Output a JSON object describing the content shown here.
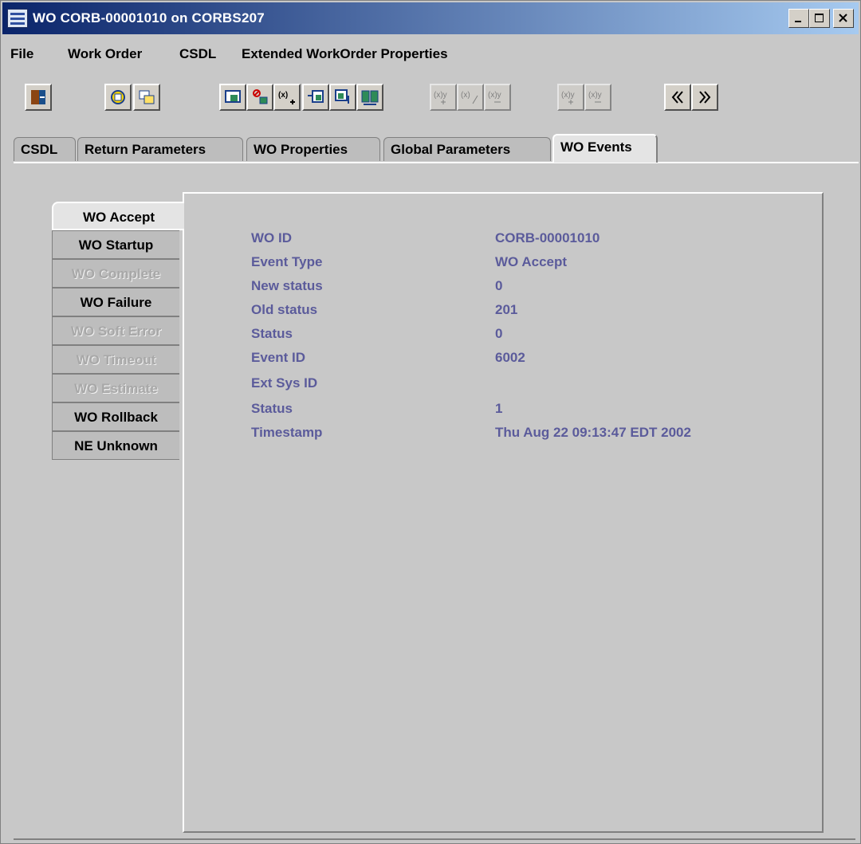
{
  "window": {
    "title": "WO CORB-00001010 on CORBS207",
    "controls": [
      "minimize-icon",
      "maximize-icon",
      "close-icon"
    ]
  },
  "menu": {
    "file": "File",
    "work_order": "Work Order",
    "csdl": "CSDL",
    "extended": "Extended WorkOrder Properties"
  },
  "toolbar": {
    "buttons": [
      {
        "icon": "exit-icon",
        "enabled": true
      },
      {
        "icon": "refresh-icon",
        "enabled": true
      },
      {
        "icon": "copy-window-icon",
        "enabled": true
      },
      {
        "icon": "window-in-icon",
        "enabled": true
      },
      {
        "icon": "cancel-window-icon",
        "enabled": true
      },
      {
        "icon": "add-variable-icon",
        "label": "(x)",
        "enabled": true
      },
      {
        "icon": "window-left-icon",
        "enabled": true
      },
      {
        "icon": "window-down-icon",
        "enabled": true
      },
      {
        "icon": "window-swap-icon",
        "enabled": true
      },
      {
        "icon": "add-var-icon",
        "label": "(x)y",
        "enabled": false
      },
      {
        "icon": "edit-var-icon",
        "label": "(x)",
        "enabled": false
      },
      {
        "icon": "remove-var-icon",
        "label": "(x)y",
        "enabled": false
      },
      {
        "icon": "add-var2-icon",
        "label": "(x)y",
        "enabled": false
      },
      {
        "icon": "remove-var2-icon",
        "label": "(x)y",
        "enabled": false
      },
      {
        "icon": "previous-icon",
        "enabled": true
      },
      {
        "icon": "next-icon",
        "enabled": true
      }
    ]
  },
  "tabs": [
    {
      "label": "CSDL"
    },
    {
      "label": "Return Parameters"
    },
    {
      "label": "WO Properties"
    },
    {
      "label": "Global Parameters"
    },
    {
      "label": "WO Events",
      "active": true
    }
  ],
  "event_tabs": [
    {
      "label": "WO Accept",
      "state": "active"
    },
    {
      "label": "WO Startup",
      "state": "enabled"
    },
    {
      "label": "WO Complete",
      "state": "disabled"
    },
    {
      "label": "WO Failure",
      "state": "enabled"
    },
    {
      "label": "WO Soft Error",
      "state": "disabled"
    },
    {
      "label": "WO Timeout",
      "state": "disabled"
    },
    {
      "label": "WO Estimate",
      "state": "disabled"
    },
    {
      "label": "WO Rollback",
      "state": "enabled"
    },
    {
      "label": "NE Unknown",
      "state": "enabled"
    }
  ],
  "event_details": [
    {
      "label": "WO ID",
      "value": "CORB-00001010"
    },
    {
      "label": "Event Type",
      "value": "WO Accept"
    },
    {
      "label": "New status",
      "value": "0"
    },
    {
      "label": "Old status",
      "value": "201"
    },
    {
      "label": "Status",
      "value": "0"
    },
    {
      "label": "Event ID",
      "value": "6002"
    },
    {
      "label": "Ext Sys ID",
      "value": ""
    },
    {
      "label": "Status",
      "value": "1"
    },
    {
      "label": "Timestamp",
      "value": "Thu Aug 22 09:13:47 EDT 2002"
    }
  ],
  "colors": {
    "title_start": "#0a246a",
    "title_end": "#a6caf0",
    "field_text": "#5b5b9b",
    "background": "#c8c8c8"
  }
}
